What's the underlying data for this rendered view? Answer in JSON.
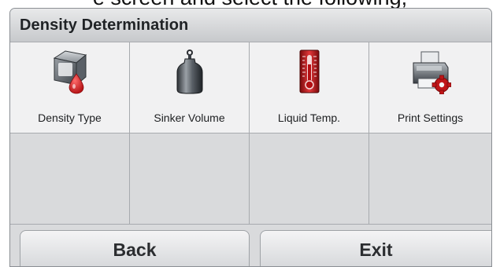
{
  "caption": "e screen and select the following,",
  "screen": {
    "title": "Density Determination",
    "tiles": [
      {
        "label": "Density Type",
        "icon": "density-type-icon"
      },
      {
        "label": "Sinker Volume",
        "icon": "sinker-weight-icon"
      },
      {
        "label": "Liquid Temp.",
        "icon": "thermometer-icon"
      },
      {
        "label": "Print Settings",
        "icon": "printer-settings-icon"
      }
    ],
    "buttons": {
      "back": "Back",
      "exit": "Exit"
    }
  },
  "colors": {
    "panel_bg": "#d9dadc",
    "tile_bg": "#f1f1f2",
    "title_text": "#1f2225",
    "accent_red": "#c01518"
  }
}
